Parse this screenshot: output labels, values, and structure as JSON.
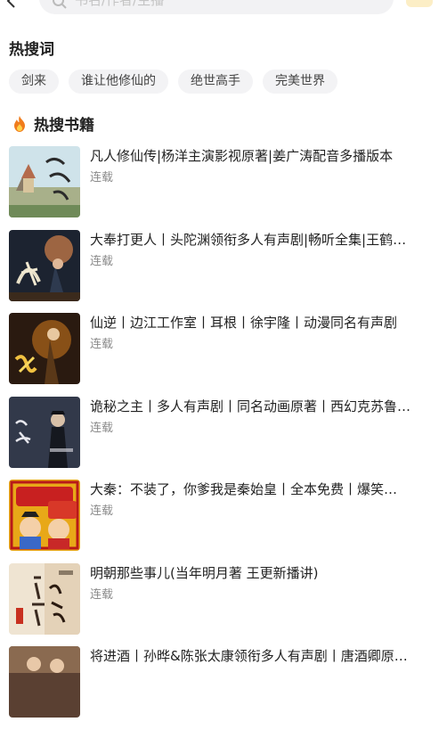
{
  "search": {
    "placeholder": "书名/作者/主播"
  },
  "hot_words": {
    "title": "热搜词",
    "items": [
      "剑来",
      "谁让他修仙的",
      "绝世高手",
      "完美世界"
    ]
  },
  "hot_books": {
    "title": "热搜书籍",
    "icon": "flame-icon",
    "accent": "#f07c1c",
    "items": [
      {
        "title": "凡人修仙传|杨洋主演影视原著|姜广涛配音多播版本",
        "status": "连载"
      },
      {
        "title": "大奉打更人丨头陀渊领衔多人有声剧|畅听全集|王鹤…",
        "status": "连载"
      },
      {
        "title": "仙逆丨边江工作室丨耳根丨徐宇隆丨动漫同名有声剧",
        "status": "连载"
      },
      {
        "title": "诡秘之主丨多人有声剧丨同名动画原著丨西幻克苏鲁…",
        "status": "连载"
      },
      {
        "title": "大秦：不装了，你爹我是秦始皇丨全本免费丨爆笑…",
        "status": "连载"
      },
      {
        "title": "明朝那些事儿(当年明月著 王更新播讲)",
        "status": "连载"
      },
      {
        "title": "将进酒丨孙晔&陈张太康领衔多人有声剧丨唐酒卿原…",
        "status": ""
      }
    ]
  }
}
